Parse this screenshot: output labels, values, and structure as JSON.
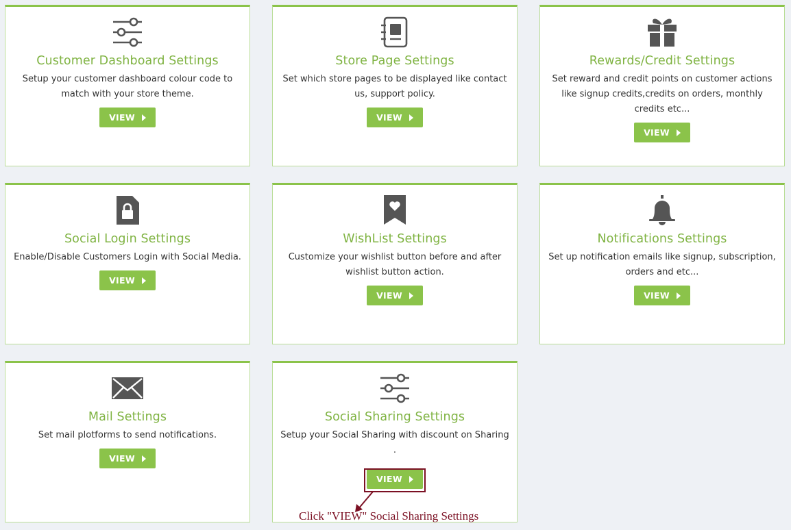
{
  "cards": [
    {
      "title": "Customer Dashboard Settings",
      "desc": "Setup your customer dashboard colour code to match with your store theme.",
      "button": "VIEW",
      "icon": "sliders-icon"
    },
    {
      "title": "Store Page Settings",
      "desc": "Set which store pages to be displayed like contact us, support policy.",
      "button": "VIEW",
      "icon": "notebook-icon"
    },
    {
      "title": "Rewards/Credit Settings",
      "desc": "Set reward and credit points on customer actions like signup credits,credits on orders, monthly credits etc...",
      "button": "VIEW",
      "icon": "gift-icon"
    },
    {
      "title": "Social Login Settings",
      "desc": "Enable/Disable Customers Login with Social Media.",
      "button": "VIEW",
      "icon": "file-lock-icon"
    },
    {
      "title": "WishList Settings",
      "desc": "Customize your wishlist button before and after wishlist button action.",
      "button": "VIEW",
      "icon": "bookmark-heart-icon"
    },
    {
      "title": "Notifications Settings",
      "desc": "Set up notification emails like signup, subscription, orders and etc...",
      "button": "VIEW",
      "icon": "bell-icon"
    },
    {
      "title": "Mail Settings",
      "desc": "Set mail plotforms to send notifications.",
      "button": "VIEW",
      "icon": "envelope-icon"
    },
    {
      "title": "Social Sharing Settings",
      "desc": "Setup your Social Sharing with discount on Sharing .",
      "button": "VIEW",
      "icon": "sliders-icon"
    }
  ],
  "annotation": {
    "text": "Click \"VIEW\" Social Sharing Settings"
  },
  "colors": {
    "accent": "#8bc34a",
    "title": "#7fb342",
    "icon": "#555555",
    "annotation": "#7b1023"
  }
}
